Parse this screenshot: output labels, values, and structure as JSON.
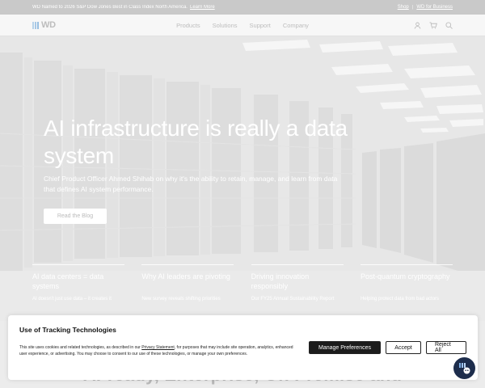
{
  "announcement": {
    "message": "WD Named to 2026 S&P Dow Jones Best in Class Index North America.",
    "learn_more": "Learn More",
    "shop": "Shop",
    "separator": "|",
    "business": "WD for Business"
  },
  "header": {
    "logo": "WD",
    "nav": [
      "Products",
      "Solutions",
      "Support",
      "Company"
    ],
    "icons": [
      "user-icon",
      "cart-icon",
      "search-icon"
    ]
  },
  "hero": {
    "title": "AI infrastructure is really a data system",
    "subtitle": "Chief Product Officer Ahmed Shihab on why it's the ability to retain, manage, and learn from data that defines AI system performance.",
    "button": "Read the Blog",
    "cards": [
      {
        "title": "AI data centers = data systems",
        "desc": "AI doesn't just use data – it creates it"
      },
      {
        "title": "Why AI leaders are pivoting",
        "desc": "New survey reveals shifting priorities"
      },
      {
        "title": "Driving innovation responsibly",
        "desc": "Our FY25 Annual Sustainability Report"
      },
      {
        "title": "Post-quantum cryptography",
        "desc": "Helping protect data from bad actors"
      }
    ]
  },
  "below": {
    "text": "AI-ready, Enterprise, On Premise and"
  },
  "cookie": {
    "title": "Use of Tracking Technologies",
    "body_before": "This site uses cookies and related technologies, as described in our ",
    "privacy_link": "Privacy Statement",
    "body_after": ", for purposes that may include site operation, analytics, enhanced user experience, or advertising. You may choose to consent to our use of these technologies, or manage your own preferences.",
    "manage": "Manage Preferences",
    "accept": "Accept",
    "reject": "Reject All"
  },
  "colors": {
    "hero_overlay": "#e4e4e4",
    "announce_bg": "#c9c9c9",
    "chat_bg": "#1d2d4c"
  }
}
